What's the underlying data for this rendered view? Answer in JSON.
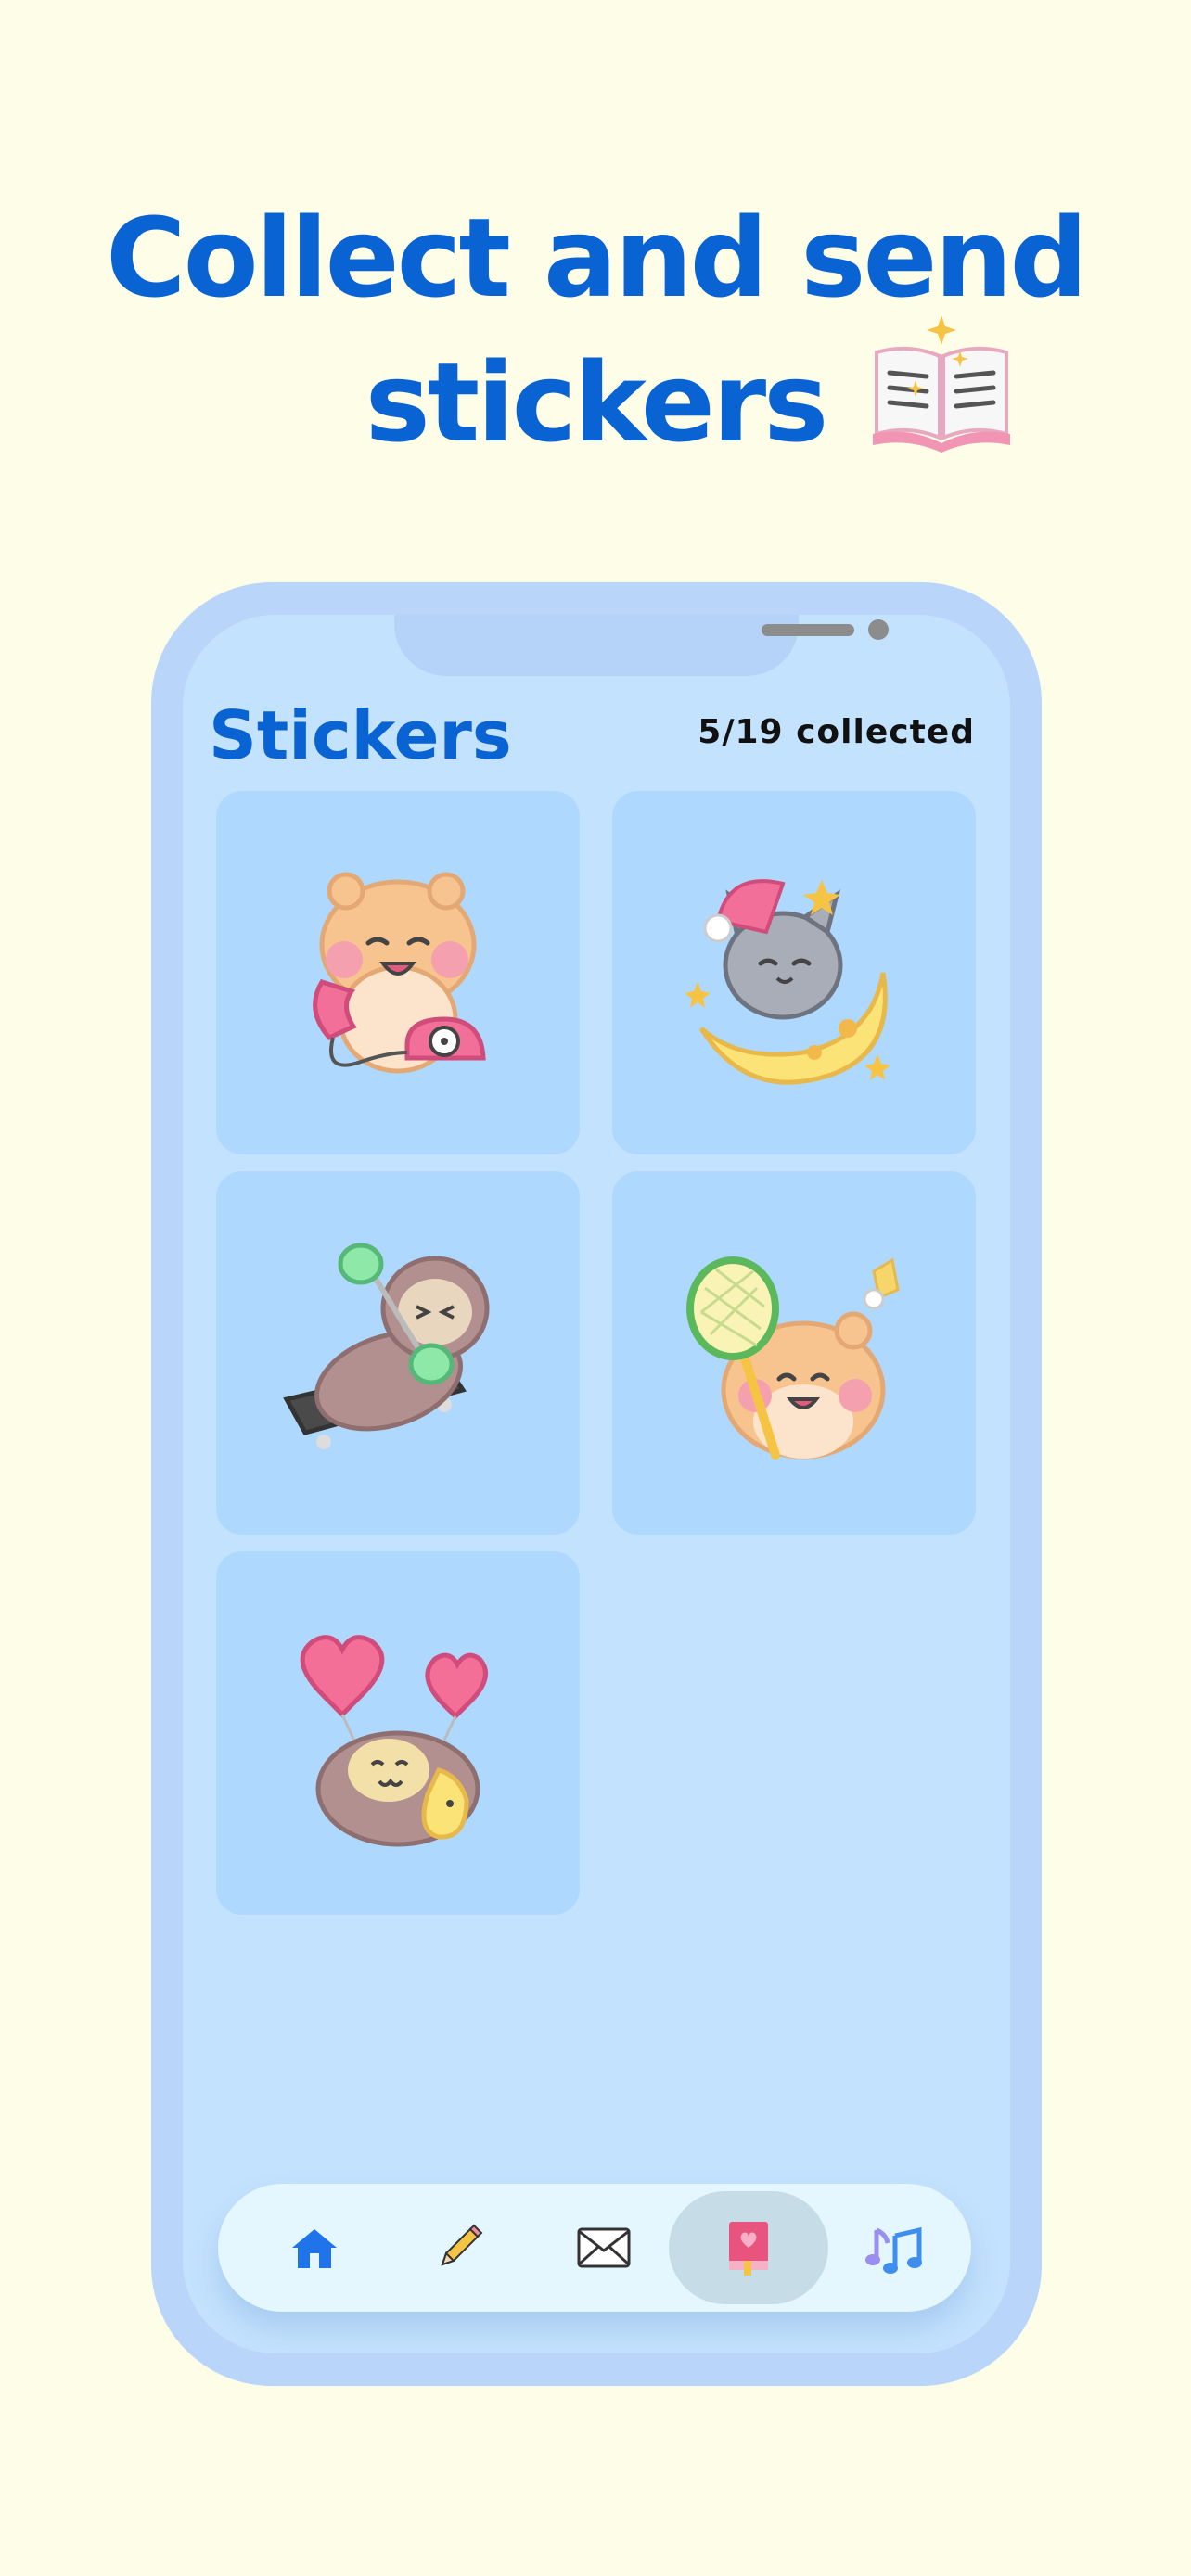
{
  "headline": {
    "line1": "Collect and send",
    "line2": "stickers",
    "icon": "open-book-sparkle-icon"
  },
  "screen": {
    "title": "Stickers",
    "collected": "5/19 collected"
  },
  "stickers": [
    {
      "name": "hamster-phone-sticker"
    },
    {
      "name": "cat-moon-sticker"
    },
    {
      "name": "sloth-workout-sticker"
    },
    {
      "name": "hamster-badminton-sticker"
    },
    {
      "name": "monkey-balloons-sticker"
    }
  ],
  "tabs": [
    {
      "name": "home-icon",
      "active": false
    },
    {
      "name": "pencil-icon",
      "active": false
    },
    {
      "name": "envelope-icon",
      "active": false
    },
    {
      "name": "sticker-book-icon",
      "active": true
    },
    {
      "name": "music-notes-icon",
      "active": false
    }
  ],
  "colors": {
    "background": "#FDFDE8",
    "accent": "#0A63D3",
    "phone_frame": "#B9D6FA",
    "screen": "#C3E2FE",
    "tile": "#AED8FE",
    "tabbar": "#E5F7FE",
    "tab_active": "#C6DDE8"
  }
}
